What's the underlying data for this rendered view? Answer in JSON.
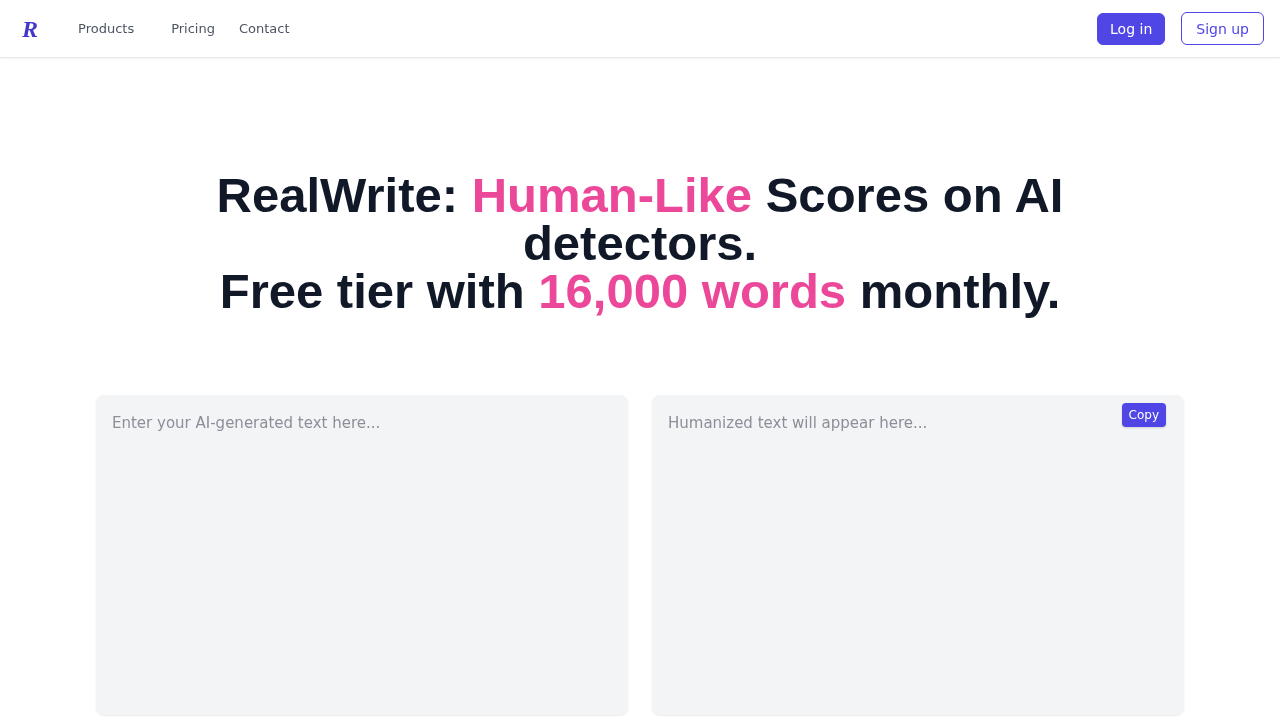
{
  "header": {
    "logo": "R",
    "nav": [
      {
        "label": "Products"
      },
      {
        "label": "Pricing"
      },
      {
        "label": "Contact"
      }
    ],
    "actions": [
      {
        "label": "Log in",
        "kind": "primary"
      },
      {
        "label": "Sign up",
        "kind": "outline"
      }
    ]
  },
  "hero": {
    "heading": [
      [
        {
          "text": "RealWrite: ",
          "highlight": false
        },
        {
          "text": "Human-Like",
          "highlight": true
        },
        {
          "text": " Scores on AI detectors.",
          "highlight": false
        }
      ],
      [
        {
          "text": "Free tier with ",
          "highlight": false
        },
        {
          "text": "16,000 words",
          "highlight": true
        },
        {
          "text": " monthly.",
          "highlight": false
        }
      ]
    ]
  },
  "editor": {
    "input": {
      "placeholder": "Enter your AI-generated text here..."
    },
    "output": {
      "placeholder": "Humanized text will appear here...",
      "copy_button": "Copy"
    }
  }
}
